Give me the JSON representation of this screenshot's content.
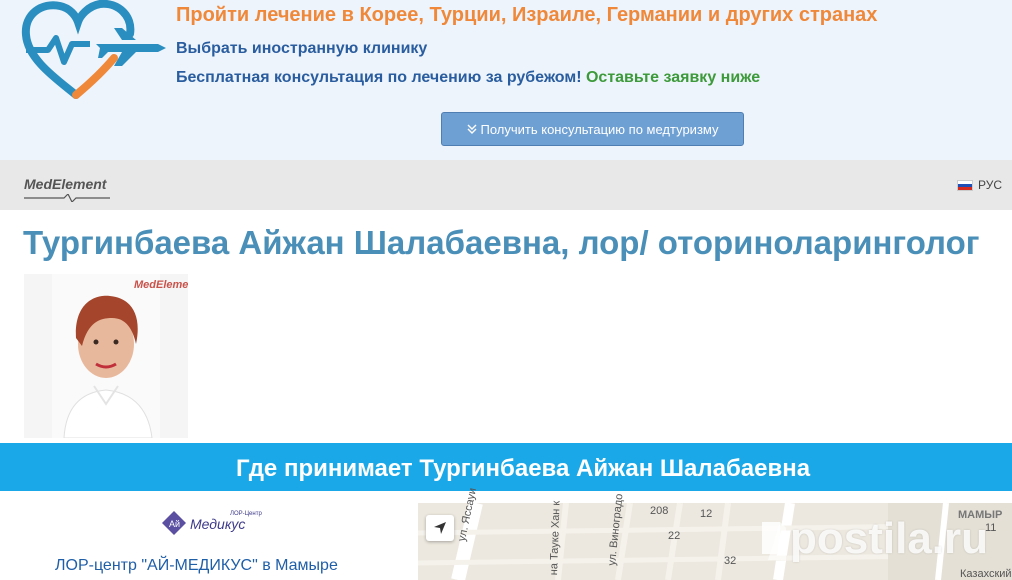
{
  "promo": {
    "title": "Пройти лечение в Корее, Турции, Израиле, Германии и других странах",
    "line1": "Выбрать иностранную клинику",
    "line2_main": "Бесплатная консультация по лечению за рубежом!",
    "line2_accent": "Оставьте заявку ниже",
    "consult_button": "Получить консультацию по медтуризму",
    "colors": {
      "title": "#f0883a",
      "text": "#2a5d9f",
      "accent": "#3d9a3b",
      "button": "#6fa0d4"
    }
  },
  "header": {
    "brand": "MedElement",
    "language": "РУС"
  },
  "doctor": {
    "name_title": "Тургинбаева Айжан Шалабаевна, лор/ оториноларинголог",
    "photo_watermark": "MedElement"
  },
  "where": {
    "title": "Где принимает Тургинбаева Айжан Шалабаевна",
    "banner_color": "#1aa8e8"
  },
  "clinic": {
    "logo_text": "Ай Медикус",
    "logo_sub": "ЛОР-Центр",
    "name": "ЛОР-центр \"АЙ-МЕДИКУС\" в Мамыре"
  },
  "map": {
    "labels": [
      "ул. Яссауи",
      "на Тауке Хан к",
      "ул. Виноградо",
      "208",
      "32",
      "22",
      "12",
      "МАМЫР",
      "11",
      "Казахский"
    ],
    "watermark": "postila.ru"
  }
}
